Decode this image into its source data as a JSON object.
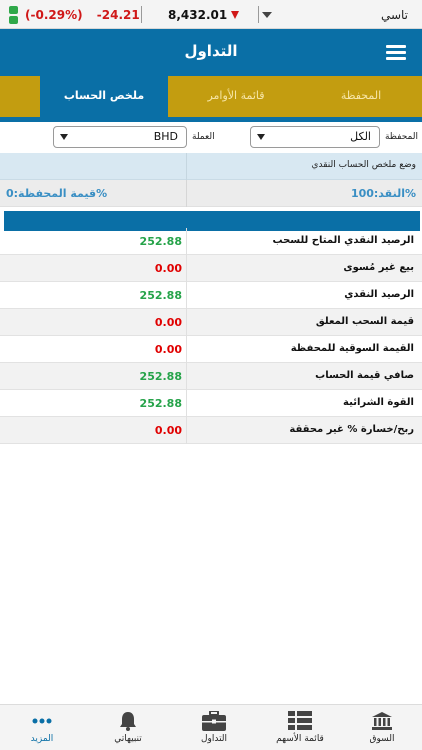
{
  "ticker": {
    "change_percent": "(-0.29%)",
    "change_value": "-24.21",
    "index_value": "8,432.01",
    "market_name": "تاسي",
    "colors": {
      "down": "#d01818",
      "status_ok": "#2fa84a"
    }
  },
  "header": {
    "title": "التداول",
    "menu_icon": "hamburger-menu-icon"
  },
  "tabs": [
    {
      "label": "المحفظة",
      "active": false
    },
    {
      "label": "قائمة الأوامر",
      "active": false
    },
    {
      "label": "ملخص الحساب",
      "active": true
    }
  ],
  "filters": {
    "portfolio_label": "المحفظة",
    "portfolio_value": "الكل",
    "currency_label": "العملة",
    "currency_value": "BHD"
  },
  "summary": {
    "section_title": "وضع ملخص الحساب النقدي",
    "cash_ratio_text": "النقد:100%",
    "portfolio_ratio_text": "قيمة المحفظة:0%",
    "cash_fraction": 1.0
  },
  "rows": [
    {
      "label": "الرصيد النقدي المتاح للسحب",
      "value": "252.88",
      "status": "positive"
    },
    {
      "label": "بيع غير مُسوى",
      "value": "0.00",
      "status": "zero"
    },
    {
      "label": "الرصيد النقدي",
      "value": "252.88",
      "status": "positive"
    },
    {
      "label": "قيمة السحب المعلق",
      "value": "0.00",
      "status": "zero"
    },
    {
      "label": "القيمة السوقية للمحفظة",
      "value": "0.00",
      "status": "zero"
    },
    {
      "label": "صافي قيمة الحساب",
      "value": "252.88",
      "status": "positive"
    },
    {
      "label": "القوة الشرائية",
      "value": "252.88",
      "status": "positive"
    },
    {
      "label": "ربح/خسارة % غير محققة",
      "value": "0.00",
      "status": "zero"
    }
  ],
  "bottom_nav": [
    {
      "label": "السوق",
      "icon": "bank-icon"
    },
    {
      "label": "قائمة الأسهم",
      "icon": "grid-list-icon"
    },
    {
      "label": "التداول",
      "icon": "briefcase-icon"
    },
    {
      "label": "تنبيهاتي",
      "icon": "bell-icon"
    },
    {
      "label": "المزيد",
      "icon": "more-dots-icon"
    }
  ]
}
